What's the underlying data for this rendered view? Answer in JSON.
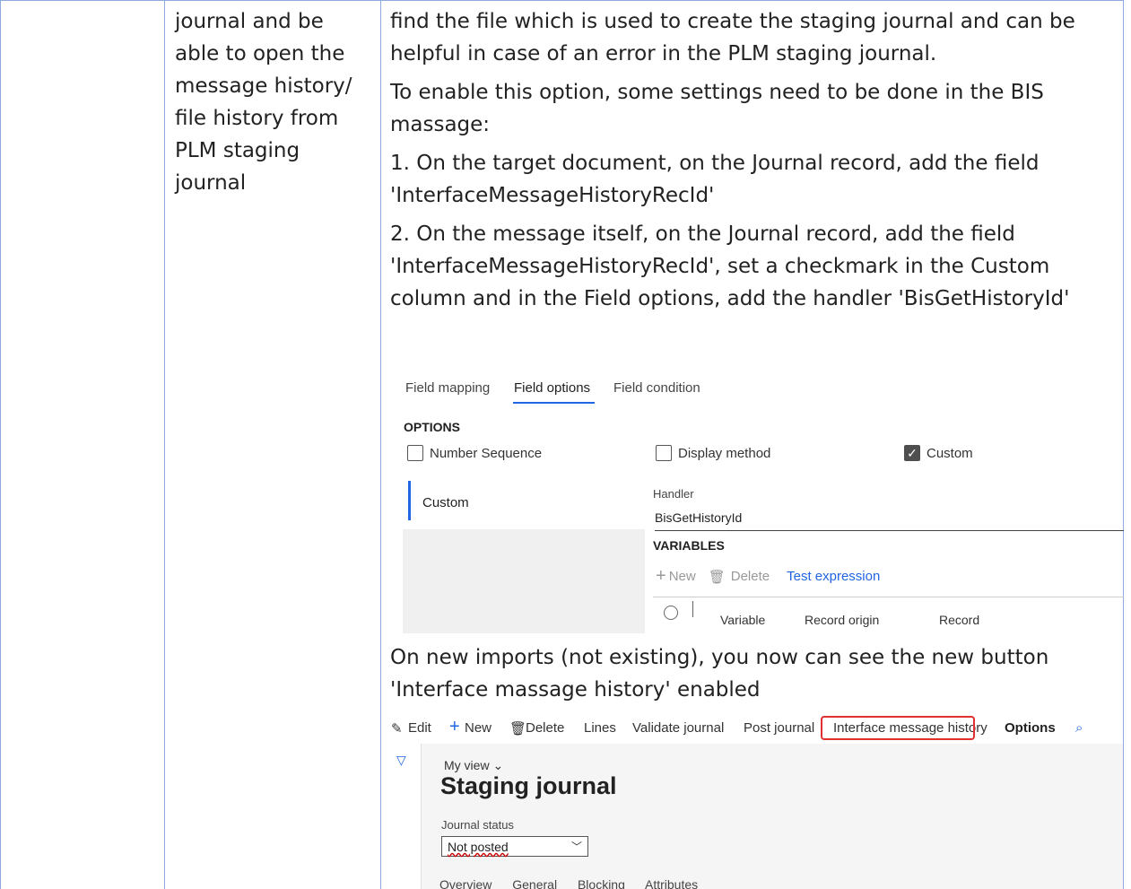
{
  "middle_cell": {
    "lines": [
      "journal and be",
      "able to open the",
      "message history/",
      "file history from",
      "PLM staging",
      "journal"
    ]
  },
  "right_cell": {
    "p1": [
      "find the file which is used to create the staging journal and can be",
      "helpful in case of an error in the PLM staging journal."
    ],
    "p2": [
      "To enable this option, some settings need to be done in the BIS",
      "massage:"
    ],
    "p3": [
      "1. On the target document, on the Journal record, add the field",
      "'InterfaceMessageHistoryRecId'"
    ],
    "p4": [
      "2. On the message itself, on the Journal record, add the field",
      "'InterfaceMessageHistoryRecId', set a checkmark in the Custom",
      "column and in the Field options, add the handler 'BisGetHistoryId'"
    ],
    "p5": [
      "On new imports (not existing), you now can see the new button",
      "'Interface massage history' enabled"
    ]
  },
  "field_options_shot": {
    "tabs": [
      "Field mapping",
      "Field options",
      "Field condition"
    ],
    "options_heading": "OPTIONS",
    "checkboxes": [
      {
        "label": "Number Sequence",
        "checked": false
      },
      {
        "label": "Display method",
        "checked": false
      },
      {
        "label": "Custom",
        "checked": true
      }
    ],
    "list_item": "Custom",
    "handler_label": "Handler",
    "handler_value": "BisGetHistoryId",
    "variables_heading": "VARIABLES",
    "toolbar": {
      "new": "New",
      "delete": "Delete",
      "test": "Test expression"
    },
    "grid_columns": [
      "Variable",
      "Record origin",
      "Record"
    ],
    "accent": "#2266e3"
  },
  "staging_shot": {
    "toolbar": {
      "edit": "Edit",
      "new": "New",
      "delete": "Delete",
      "lines": "Lines",
      "validate": "Validate journal",
      "post": "Post journal",
      "history": "Interface message history",
      "options": "Options"
    },
    "my_view": "My view",
    "title": "Staging journal",
    "status_label": "Journal status",
    "status_value": "Not posted",
    "tabs": [
      "Overview",
      "General",
      "Blocking",
      "Attributes"
    ],
    "highlight_color": "#e03030"
  }
}
